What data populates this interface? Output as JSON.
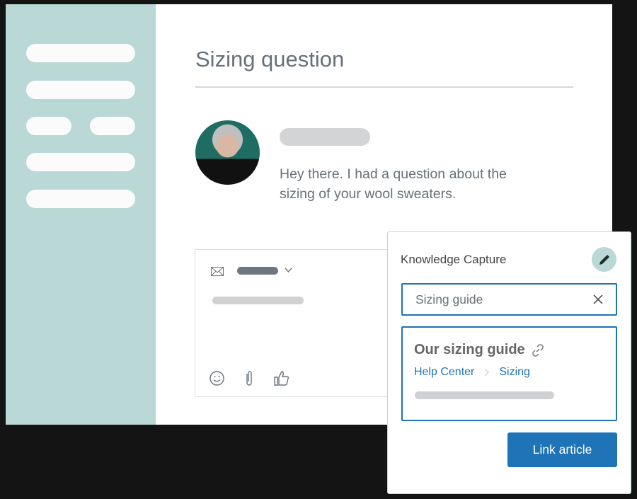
{
  "conversation": {
    "title": "Sizing question",
    "message": "Hey there. I had a question about the sizing of your wool sweaters."
  },
  "panel": {
    "title": "Knowledge Capture",
    "search_value": "Sizing guide",
    "result": {
      "title": "Our sizing guide",
      "breadcrumb": [
        "Help Center",
        "Sizing"
      ]
    },
    "button_label": "Link article"
  },
  "colors": {
    "accent": "#1f73b7",
    "sidebar": "#b9d8d6",
    "text": "#68717a"
  },
  "icons": [
    "envelope-icon",
    "chevron-down-icon",
    "emoji-icon",
    "paperclip-icon",
    "thumbs-up-icon",
    "pencil-icon",
    "close-icon",
    "link-icon",
    "chevron-right-icon"
  ]
}
